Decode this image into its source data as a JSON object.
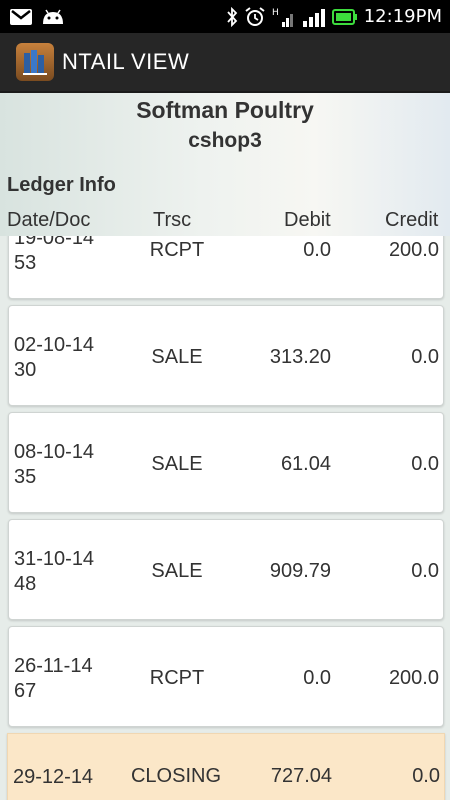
{
  "status_bar": {
    "time": "12:19PM",
    "icons": [
      "gmail-icon",
      "android-icon",
      "bluetooth-icon",
      "alarm-icon",
      "h-signal-icon",
      "signal-bars-icon",
      "battery-icon"
    ],
    "network_letter": "H"
  },
  "action_bar": {
    "title": "NTAIL VIEW",
    "app_icon": "ledger-app-icon"
  },
  "header": {
    "company": "Softman Poultry",
    "shop": "cshop3",
    "section_label": "Ledger Info",
    "columns": {
      "date_doc": "Date/Doc",
      "trsc": "Trsc",
      "debit": "Debit",
      "credit": "Credit"
    }
  },
  "rows": [
    {
      "date": "19-08-14",
      "doc": "53",
      "trsc": "RCPT",
      "debit": "0.0",
      "credit": "200.0"
    },
    {
      "date": "02-10-14",
      "doc": "30",
      "trsc": "SALE",
      "debit": "313.20",
      "credit": "0.0"
    },
    {
      "date": "08-10-14",
      "doc": "35",
      "trsc": "SALE",
      "debit": "61.04",
      "credit": "0.0"
    },
    {
      "date": "31-10-14",
      "doc": "48",
      "trsc": "SALE",
      "debit": "909.79",
      "credit": "0.0"
    },
    {
      "date": "26-11-14",
      "doc": "67",
      "trsc": "RCPT",
      "debit": "0.0",
      "credit": "200.0"
    }
  ],
  "closing_row": {
    "date": "29-12-14",
    "trsc": "CLOSING",
    "debit": "727.04",
    "credit": "0.0"
  },
  "colors": {
    "status_bar": "#000000",
    "action_bar": "#262626",
    "closing_highlight": "#fbe7c8",
    "battery": "#3ddc3d"
  }
}
